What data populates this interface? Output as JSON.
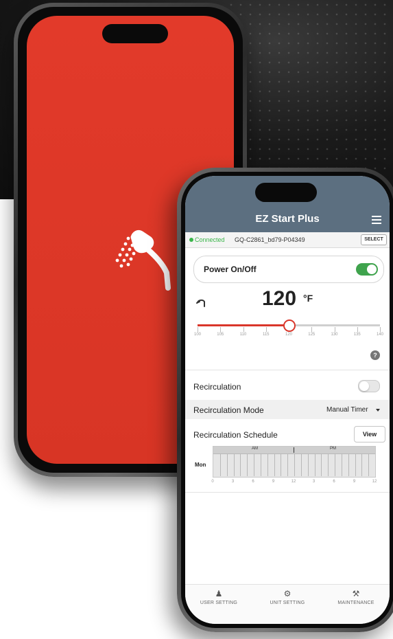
{
  "splash": {
    "icon": "shower-head-icon",
    "background_color": "#d83525"
  },
  "app": {
    "title": "EZ Start Plus",
    "header_color": "#5c6f80",
    "connection": {
      "status": "Connected",
      "device_id": "GQ-C2861_bd79-P04349",
      "select_label": "SELECT"
    },
    "power": {
      "label": "Power On/Off",
      "on": true
    },
    "temperature": {
      "value": "120",
      "unit": "°F",
      "min": 100,
      "max": 140,
      "current": 120,
      "ticks": [
        "100",
        "105",
        "110",
        "115",
        "120",
        "125",
        "130",
        "135",
        "140"
      ],
      "accent_color": "#d9362a"
    },
    "help_label": "?",
    "recirculation": {
      "label": "Recirculation",
      "on": false
    },
    "recirculation_mode": {
      "label": "Recirculation Mode",
      "value": "Manual Timer"
    },
    "recirculation_schedule": {
      "label": "Recirculation Schedule",
      "view_label": "View",
      "am_label": "AM",
      "pm_label": "PM",
      "day": "Mon",
      "hours": [
        "0",
        "3",
        "6",
        "9",
        "12",
        "3",
        "6",
        "9",
        "12"
      ]
    },
    "nav": [
      {
        "label": "USER SETTING",
        "icon": "user-gear-icon"
      },
      {
        "label": "UNIT SETTING",
        "icon": "gear-icon"
      },
      {
        "label": "MAINTENANCE",
        "icon": "tools-icon"
      }
    ]
  }
}
